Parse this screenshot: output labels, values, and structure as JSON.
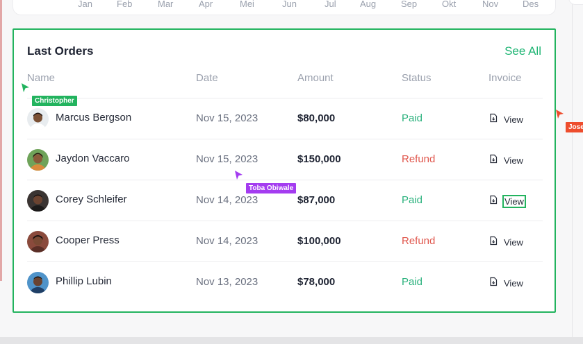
{
  "chart_axis": {
    "months": [
      "Jan",
      "Feb",
      "Mar",
      "Apr",
      "Mei",
      "Jun",
      "Jul",
      "Aug",
      "Sep",
      "Okt",
      "Nov",
      "Des"
    ]
  },
  "orders": {
    "title": "Last Orders",
    "see_all_label": "See All",
    "columns": {
      "name": "Name",
      "date": "Date",
      "amount": "Amount",
      "status": "Status",
      "invoice": "Invoice"
    },
    "rows": [
      {
        "name": "Marcus Bergson",
        "date": "Nov 15, 2023",
        "amount": "$80,000",
        "status": "Paid",
        "invoice": "View"
      },
      {
        "name": "Jaydon Vaccaro",
        "date": "Nov 15, 2023",
        "amount": "$150,000",
        "status": "Refund",
        "invoice": "View"
      },
      {
        "name": "Corey Schleifer",
        "date": "Nov 14, 2023",
        "amount": "$87,000",
        "status": "Paid",
        "invoice": "View"
      },
      {
        "name": "Cooper Press",
        "date": "Nov 14, 2023",
        "amount": "$100,000",
        "status": "Refund",
        "invoice": "View"
      },
      {
        "name": "Phillip Lubin",
        "date": "Nov 13, 2023",
        "amount": "$78,000",
        "status": "Paid",
        "invoice": "View"
      }
    ]
  },
  "collaborators": [
    {
      "name": "Christopher",
      "color": "#22b35e"
    },
    {
      "name": "Toba Obiwale",
      "color": "#a43cf0"
    },
    {
      "name": "Jose",
      "color": "#ee4d2d"
    }
  ],
  "colors": {
    "accent": "#1fb574",
    "paid": "#29b17c",
    "refund": "#e0574d",
    "focus_outline": "#22b35e"
  }
}
